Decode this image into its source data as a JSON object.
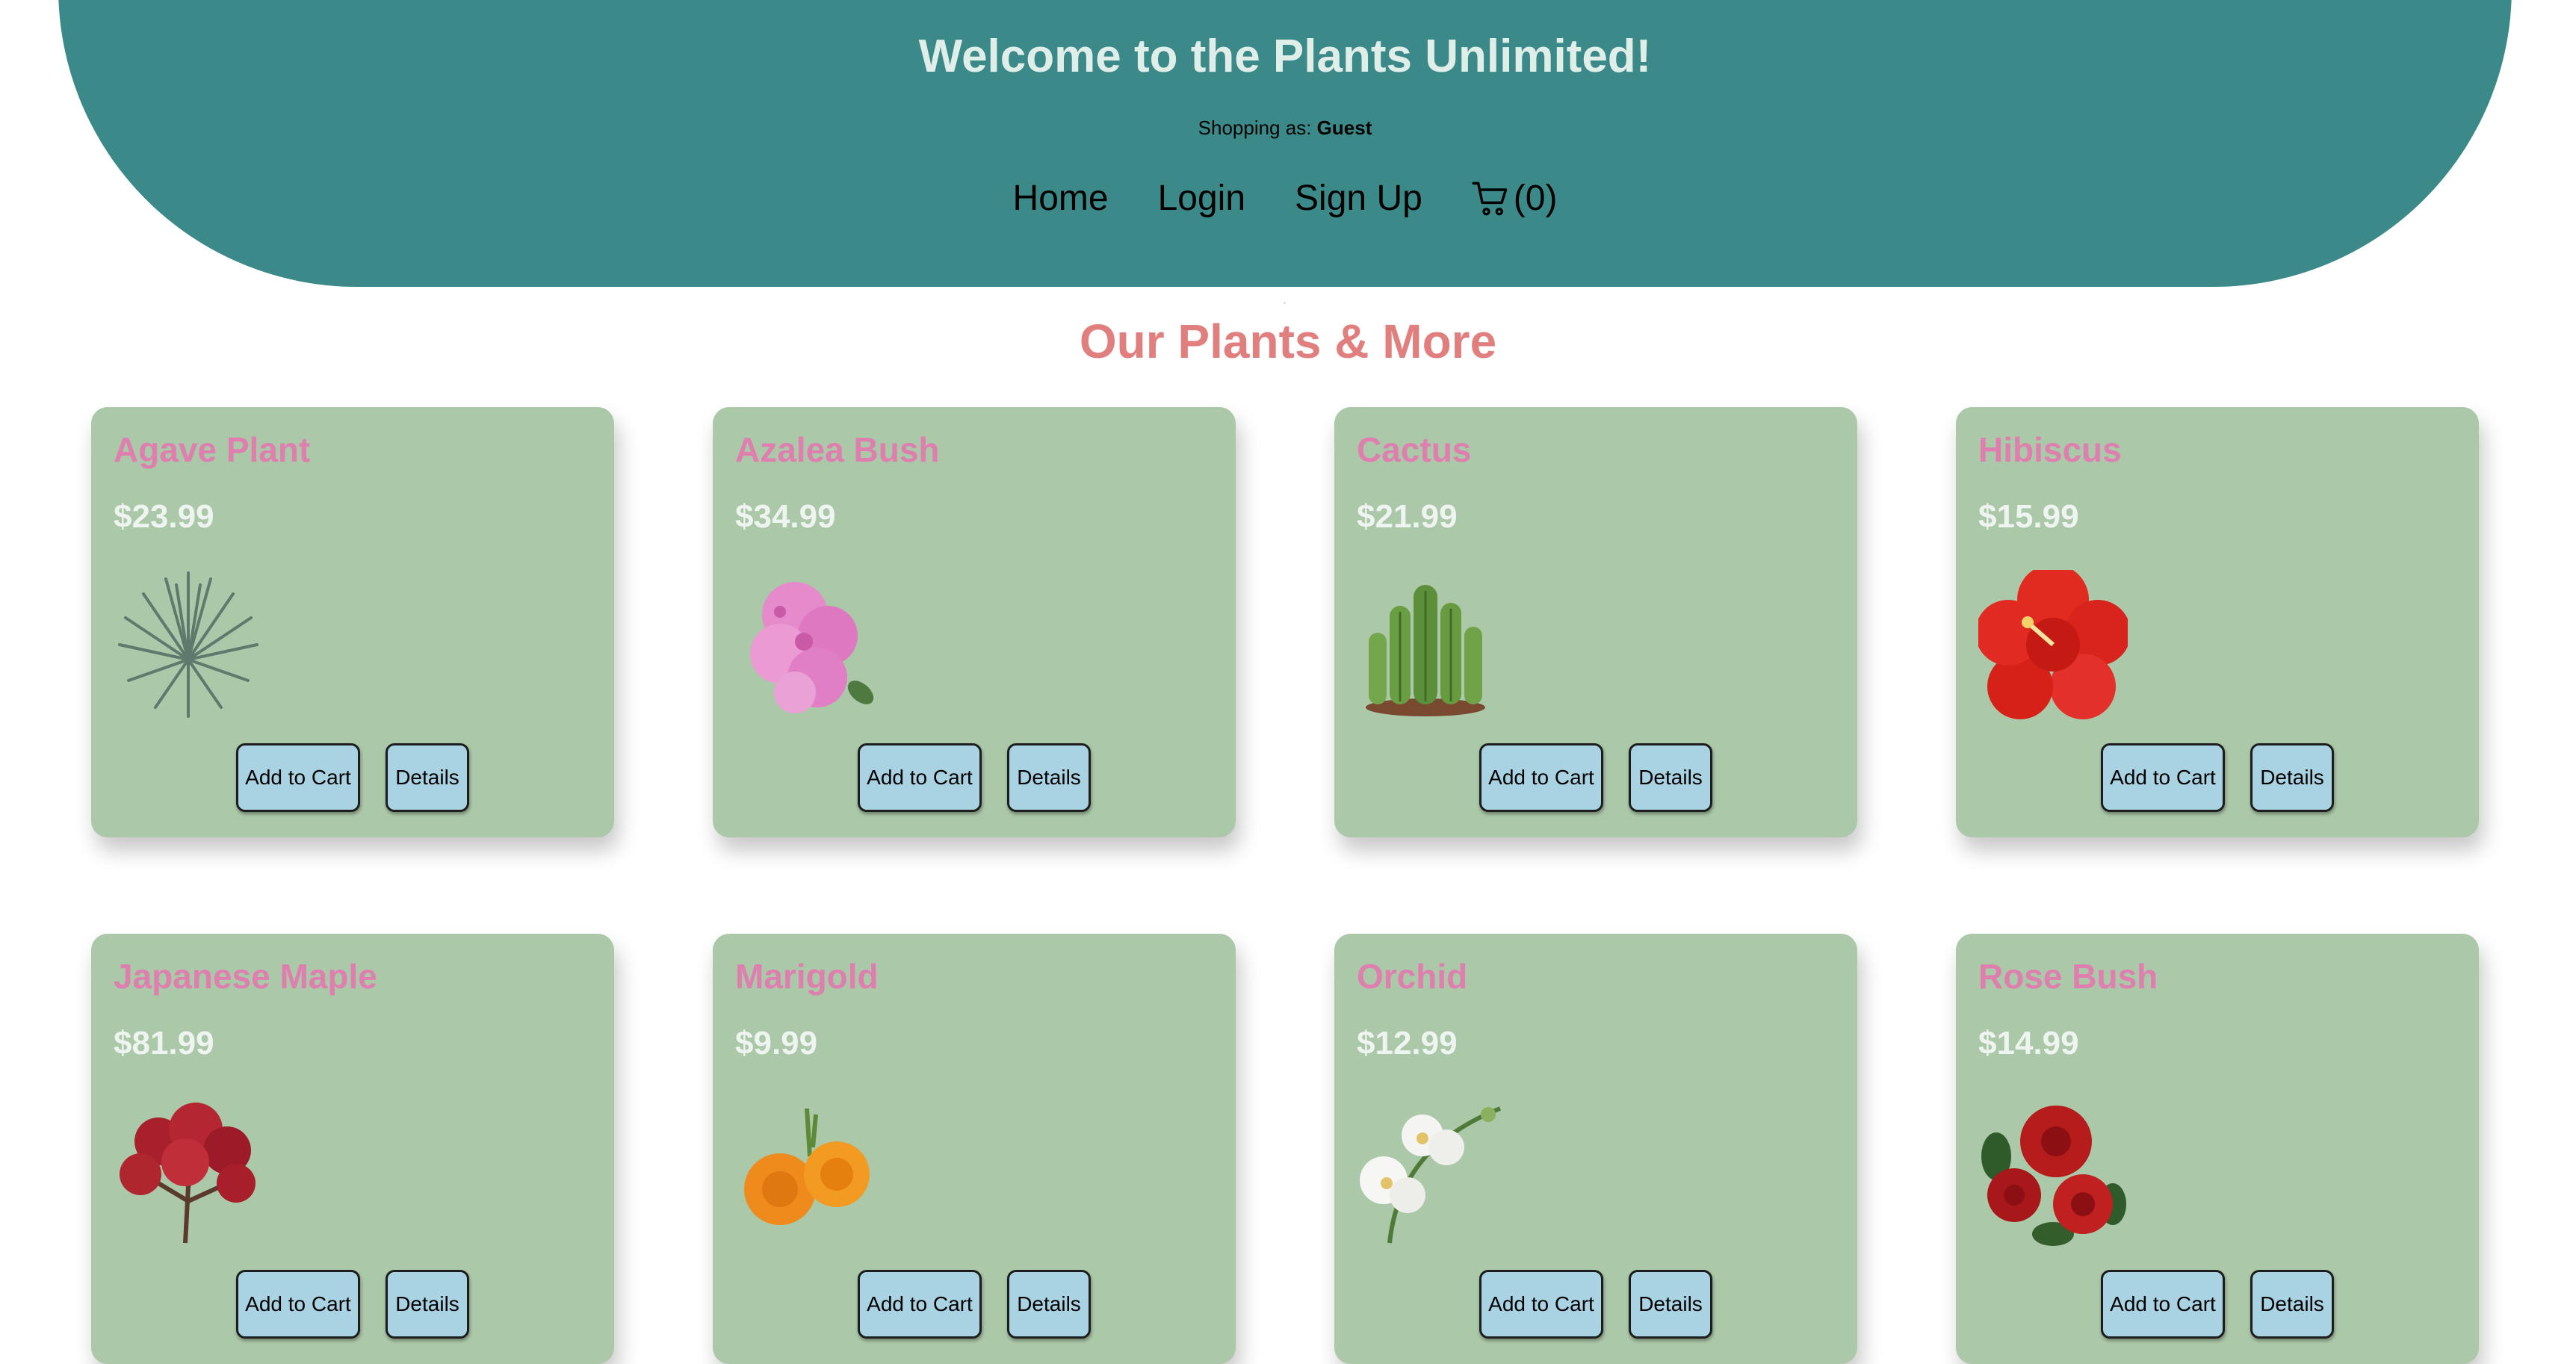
{
  "header": {
    "title": "Welcome to the Plants Unlimited!",
    "shopping_prefix": "Shopping as:",
    "shopping_user": "Guest",
    "nav": {
      "home": "Home",
      "login": "Login",
      "signup": "Sign Up",
      "cart_count": "(0)",
      "cart_icon": "shopping-cart-icon"
    }
  },
  "section_title": "Our Plants & More",
  "buttons": {
    "add_to_cart": "Add to Cart",
    "details": "Details"
  },
  "products": [
    {
      "name": "Agave Plant",
      "price": "$23.99",
      "image": "agave-plant-image"
    },
    {
      "name": "Azalea Bush",
      "price": "$34.99",
      "image": "azalea-bush-image"
    },
    {
      "name": "Cactus",
      "price": "$21.99",
      "image": "cactus-image"
    },
    {
      "name": "Hibiscus",
      "price": "$15.99",
      "image": "hibiscus-image"
    },
    {
      "name": "Japanese Maple",
      "price": "$81.99",
      "image": "japanese-maple-image"
    },
    {
      "name": "Marigold",
      "price": "$9.99",
      "image": "marigold-image"
    },
    {
      "name": "Orchid",
      "price": "$12.99",
      "image": "orchid-image"
    },
    {
      "name": "Rose Bush",
      "price": "$14.99",
      "image": "rose-bush-image"
    }
  ],
  "colors": {
    "header_bg": "#3b8a89",
    "header_title": "#dfeee9",
    "section_title": "#e07f7d",
    "card_bg": "#abc8a8",
    "product_name": "#df7faf",
    "price": "#eef4ef",
    "button_bg": "#a9d3e3"
  }
}
